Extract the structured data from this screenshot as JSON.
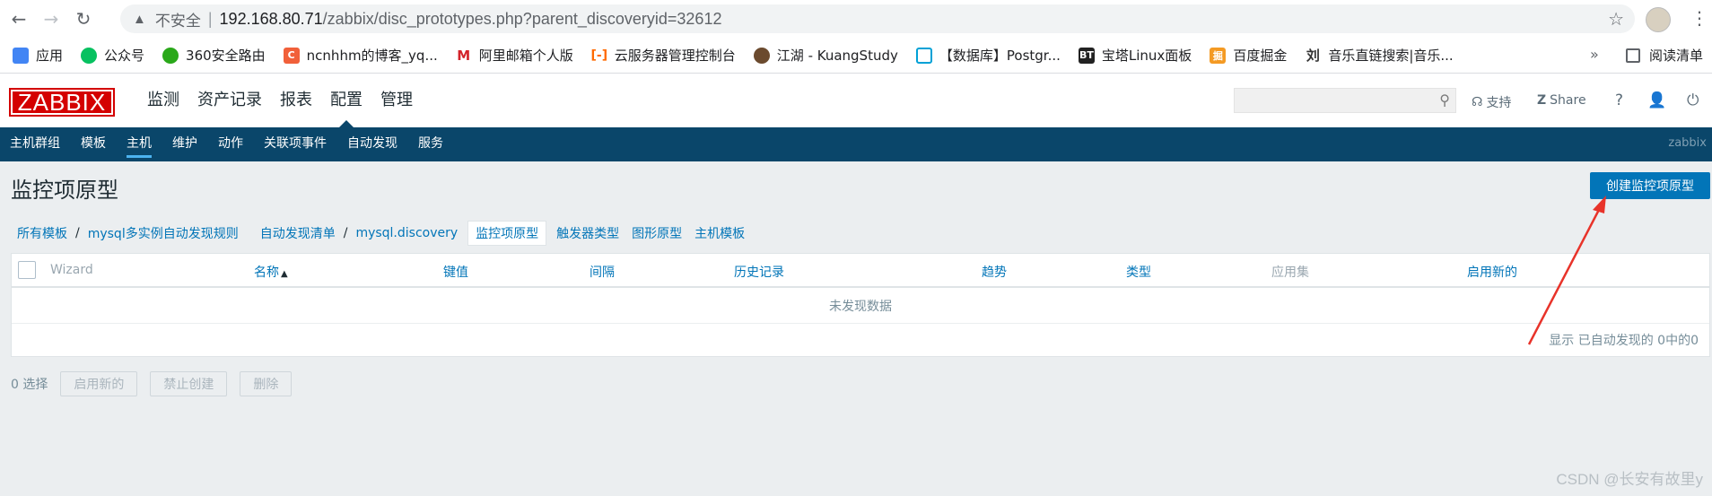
{
  "browser": {
    "insecure_label": "不安全",
    "url_host": "192.168.80.71",
    "url_path": "/zabbix/disc_prototypes.php?parent_discoveryid=32612",
    "bookmarks": [
      {
        "label": "应用",
        "color": "#4285f4"
      },
      {
        "label": "公众号",
        "color": "#07c160"
      },
      {
        "label": "360安全路由",
        "color": "#2aa81a"
      },
      {
        "label": "ncnhhm的博客_yq...",
        "color": "#f1603a"
      },
      {
        "label": "阿里邮箱个人版",
        "color": "#d3232a"
      },
      {
        "label": "云服务器管理控制台",
        "color": "#ff6a00"
      },
      {
        "label": "江湖 - KuangStudy",
        "color": "#6b4a2e"
      },
      {
        "label": "【数据库】Postgr...",
        "color": "#00a1d6"
      },
      {
        "label": "宝塔Linux面板",
        "color": "#222222"
      },
      {
        "label": "百度掘金",
        "color": "#f49a23"
      },
      {
        "label": "音乐直链搜索|音乐...",
        "color": "#333333"
      }
    ],
    "more": "»",
    "reading_list": "阅读清单"
  },
  "header": {
    "logo": "ZABBIX",
    "menu": [
      "监测",
      "资产记录",
      "报表",
      "配置",
      "管理"
    ],
    "active_menu_index": 3,
    "support": "支持",
    "share": "Share",
    "help": "?"
  },
  "submenu": {
    "items": [
      "主机群组",
      "模板",
      "主机",
      "维护",
      "动作",
      "关联项事件",
      "自动发现",
      "服务"
    ],
    "active_index": 2,
    "server_name": "zabbix"
  },
  "page": {
    "title": "监控项原型",
    "create_button": "创建监控项原型"
  },
  "breadcrumbs": {
    "all_templates": "所有模板",
    "template": "mysql多实例自动发现规则",
    "discovery_list": "自动发现清单",
    "discovery_rule": "mysql.discovery",
    "item_prototypes": "监控项原型",
    "trigger_prototypes": "触发器类型",
    "graph_prototypes": "图形原型",
    "host_prototypes": "主机模板"
  },
  "table": {
    "columns": {
      "wizard": "Wizard",
      "name": "名称",
      "key": "键值",
      "interval": "间隔",
      "history": "历史记录",
      "trends": "趋势",
      "type": "类型",
      "applications": "应用集",
      "create_enabled": "启用新的"
    },
    "sort_indicator": "▲",
    "empty_text": "未发现数据",
    "footer": "显示 已自动发现的 0中的0"
  },
  "mass_actions": {
    "selected_count": "0 选择",
    "enable": "启用新的",
    "disable": "禁止创建",
    "delete": "删除"
  },
  "watermark": "CSDN @长安有故里y",
  "colors": {
    "brand_red": "#d40000",
    "nav_blue": "#0a466a",
    "link_blue": "#0275b8",
    "annotation_red": "#e8332a"
  }
}
